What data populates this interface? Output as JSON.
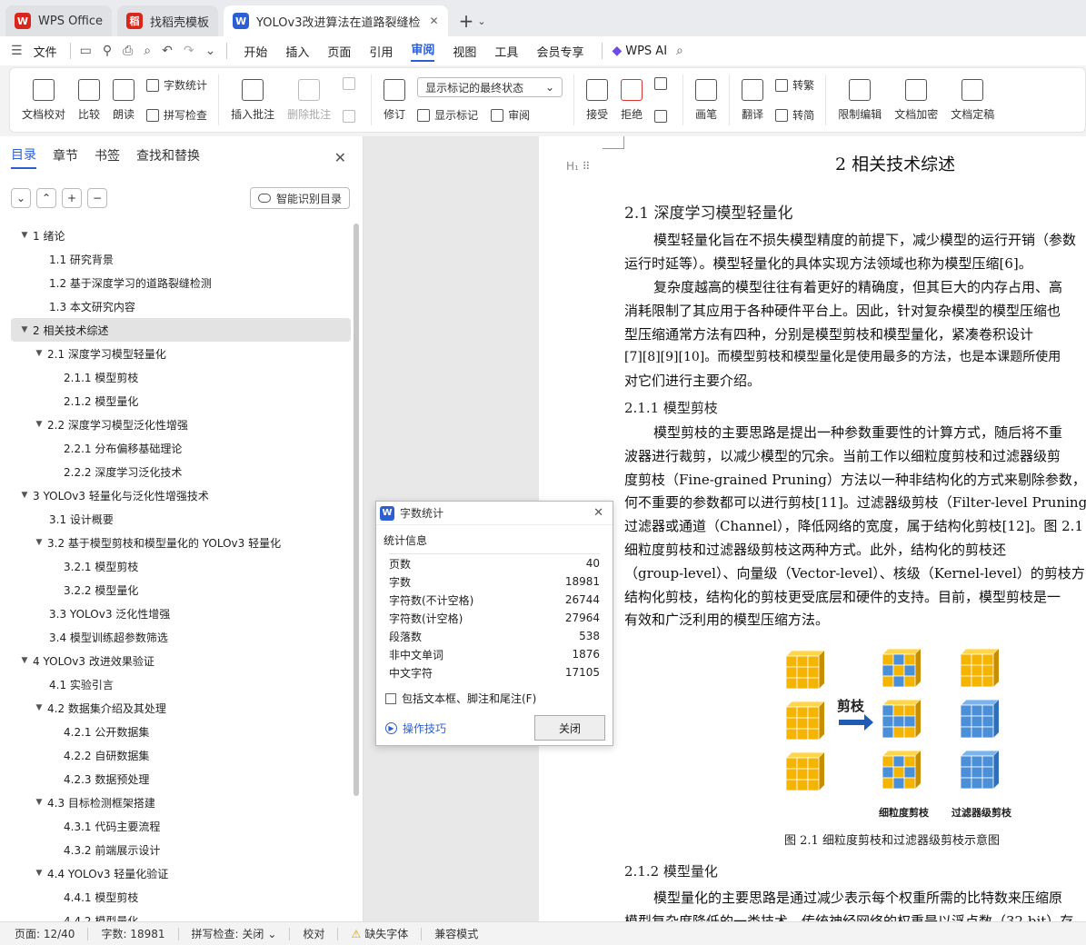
{
  "tabs": [
    {
      "label": "WPS Office",
      "logo": "W",
      "color": "#d9261c"
    },
    {
      "label": "找稻壳模板",
      "logo": "稻",
      "color": "#d9261c"
    },
    {
      "label": "YOLOv3改进算法在道路裂缝检",
      "logo": "W",
      "color": "#2c5fd6"
    }
  ],
  "menu": {
    "file": "文件",
    "items": [
      "开始",
      "插入",
      "页面",
      "引用",
      "审阅",
      "视图",
      "工具",
      "会员专享"
    ],
    "active": "审阅",
    "wps_ai": "WPS AI"
  },
  "ribbon": {
    "doc_check": "文档校对",
    "compare": "比较",
    "read_aloud": "朗读",
    "word_count": "字数统计",
    "spell_check": "拼写检查",
    "insert_comment": "插入批注",
    "delete_comment": "删除批注",
    "revise": "修订",
    "markup_state": "显示标记的最终状态",
    "show_markup": "显示标记",
    "review_pane": "审阅",
    "accept": "接受",
    "reject": "拒绝",
    "pen": "画笔",
    "translate": "翻译",
    "to_traditional": "转繁",
    "to_simplified": "转简",
    "restrict_edit": "限制编辑",
    "encrypt": "文档加密",
    "finalize": "文档定稿"
  },
  "panel": {
    "tabs": [
      "目录",
      "章节",
      "书签",
      "查找和替换"
    ],
    "smart_toc": "智能识别目录",
    "toc": [
      {
        "label": "1  绪论",
        "level": 1,
        "arrow": true
      },
      {
        "label": "1.1  研究背景",
        "level": 2,
        "arrow": false
      },
      {
        "label": "1.2  基于深度学习的道路裂缝检测",
        "level": 2,
        "arrow": false
      },
      {
        "label": "1.3  本文研究内容",
        "level": 2,
        "arrow": false
      },
      {
        "label": "2  相关技术综述",
        "level": 1,
        "arrow": true,
        "selected": true
      },
      {
        "label": "2.1  深度学习模型轻量化",
        "level": 2,
        "arrow": true
      },
      {
        "label": "2.1.1  模型剪枝",
        "level": 3,
        "arrow": false
      },
      {
        "label": "2.1.2  模型量化",
        "level": 3,
        "arrow": false
      },
      {
        "label": "2.2  深度学习模型泛化性增强",
        "level": 2,
        "arrow": true
      },
      {
        "label": "2.2.1  分布偏移基础理论",
        "level": 3,
        "arrow": false
      },
      {
        "label": "2.2.2  深度学习泛化技术",
        "level": 3,
        "arrow": false
      },
      {
        "label": "3  YOLOv3 轻量化与泛化性增强技术",
        "level": 1,
        "arrow": true
      },
      {
        "label": "3.1  设计概要",
        "level": 2,
        "arrow": false
      },
      {
        "label": "3.2  基于模型剪枝和模型量化的 YOLOv3 轻量化",
        "level": 2,
        "arrow": true
      },
      {
        "label": "3.2.1  模型剪枝",
        "level": 3,
        "arrow": false
      },
      {
        "label": "3.2.2  模型量化",
        "level": 3,
        "arrow": false
      },
      {
        "label": "3.3 YOLOv3 泛化性增强",
        "level": 2,
        "arrow": false
      },
      {
        "label": "3.4  模型训练超参数筛选",
        "level": 2,
        "arrow": false
      },
      {
        "label": "4 YOLOv3 改进效果验证",
        "level": 1,
        "arrow": true
      },
      {
        "label": "4.1  实验引言",
        "level": 2,
        "arrow": false
      },
      {
        "label": "4.2  数据集介绍及其处理",
        "level": 2,
        "arrow": true
      },
      {
        "label": "4.2.1  公开数据集",
        "level": 3,
        "arrow": false
      },
      {
        "label": "4.2.2  自研数据集",
        "level": 3,
        "arrow": false
      },
      {
        "label": "4.2.3  数据预处理",
        "level": 3,
        "arrow": false
      },
      {
        "label": "4.3  目标检测框架搭建",
        "level": 2,
        "arrow": true
      },
      {
        "label": "4.3.1  代码主要流程",
        "level": 3,
        "arrow": false
      },
      {
        "label": "4.3.2  前端展示设计",
        "level": 3,
        "arrow": false
      },
      {
        "label": "4.4 YOLOv3 轻量化验证",
        "level": 2,
        "arrow": true
      },
      {
        "label": "4.4.1  模型剪枝",
        "level": 3,
        "arrow": false
      },
      {
        "label": "4.4.2  模型量化",
        "level": 3,
        "arrow": false
      }
    ]
  },
  "document": {
    "heading_mark": "H",
    "chapter_title": "2  相关技术综述",
    "h2_1": "2.1  深度学习模型轻量化",
    "para1": [
      "模型轻量化旨在不损失模型精度的前提下，减少模型的运行开销（参数",
      "运行时延等）。模型轻量化的具体实现方法领域也称为模型压缩[6]。"
    ],
    "para2": [
      "复杂度越高的模型往往有着更好的精确度，但其巨大的内存占用、高",
      "消耗限制了其应用于各种硬件平台上。因此，针对复杂模型的模型压缩也",
      "型压缩通常方法有四种，分别是模型剪枝和模型量化，紧凑卷积设计",
      "[7][8][9][10]。而模型剪枝和模型量化是使用最多的方法，也是本课题所使用",
      "对它们进行主要介绍。"
    ],
    "h3_1": "2.1.1  模型剪枝",
    "para3": [
      "模型剪枝的主要思路是提出一种参数重要性的计算方式，随后将不重",
      "波器进行裁剪，以减少模型的冗余。当前工作以细粒度剪枝和过滤器级剪",
      "度剪枝（Fine-grained Pruning）方法以一种非结构化的方式来剔除参数，",
      "何不重要的参数都可以进行剪枝[11]。过滤器级剪枝（Filter-level Pruning）",
      "过滤器或通道（Channel），降低网络的宽度，属于结构化剪枝[12]。图 2.1",
      "细粒度剪枝和过滤器级剪枝这两种方式。此外，结构化的剪枝还",
      "（group-level）、向量级（Vector-level）、核级（Kernel-level）的剪枝方",
      "结构化剪枝，结构化的剪枝更受底层和硬件的支持。目前，模型剪枝是一",
      "有效和广泛利用的模型压缩方法。"
    ],
    "figure": {
      "arrow_label": "剪枝",
      "label_fine": "细粒度剪枝",
      "label_filter": "过滤器级剪枝",
      "caption": "图 2.1  细粒度剪枝和过滤器级剪枝示意图",
      "color_yellow": "#f5b400",
      "color_blue": "#4a8fd8"
    },
    "h3_2": "2.1.2  模型量化",
    "para4": [
      "模型量化的主要思路是通过减少表示每个权重所需的比特数来压缩原",
      "模型复杂度降低的一类技术。传统神经网络的权重是以浮点数（32 bit）存"
    ]
  },
  "dialog": {
    "title": "字数统计",
    "section": "统计信息",
    "rows": [
      {
        "label": "页数",
        "value": "40"
      },
      {
        "label": "字数",
        "value": "18981"
      },
      {
        "label": "字符数(不计空格)",
        "value": "26744"
      },
      {
        "label": "字符数(计空格)",
        "value": "27964"
      },
      {
        "label": "段落数",
        "value": "538"
      },
      {
        "label": "非中文单词",
        "value": "1876"
      },
      {
        "label": "中文字符",
        "value": "17105"
      }
    ],
    "checkbox": "包括文本框、脚注和尾注(F)",
    "tips": "操作技巧",
    "close": "关闭"
  },
  "status": {
    "page": "页面: 12/40",
    "words": "字数: 18981",
    "spell": "拼写检查: 关闭",
    "proof": "校对",
    "missing_font": "缺失字体",
    "compat": "兼容模式"
  }
}
